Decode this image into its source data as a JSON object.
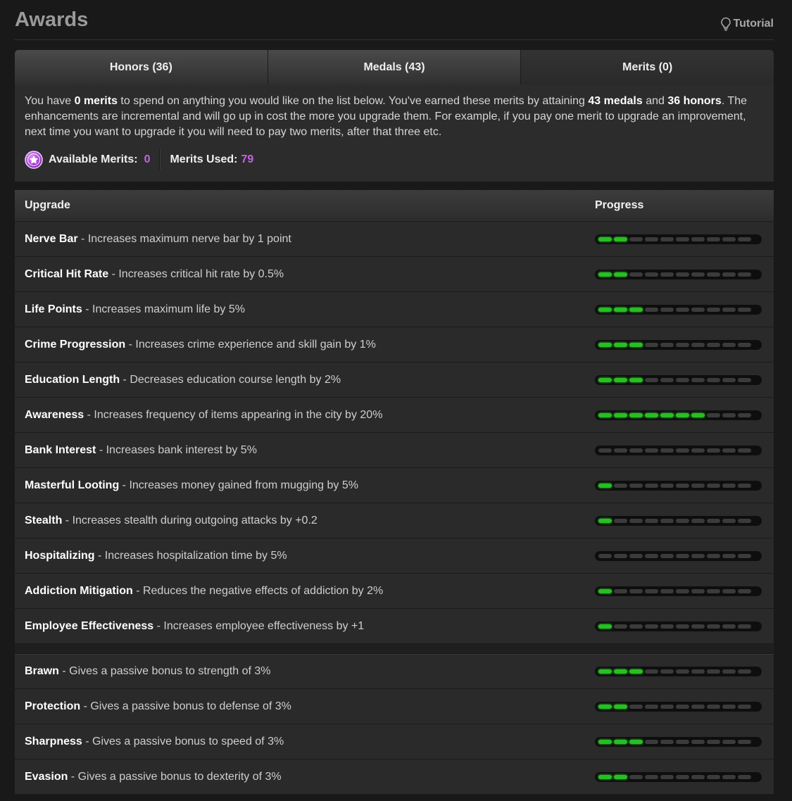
{
  "header": {
    "title": "Awards",
    "tutorial_label": "Tutorial"
  },
  "tabs": [
    {
      "label": "Honors (36)",
      "active": false
    },
    {
      "label": "Medals (43)",
      "active": false
    },
    {
      "label": "Merits (0)",
      "active": true
    }
  ],
  "info": {
    "text_1": "You have ",
    "merits_phrase": "0 merits",
    "text_2": " to spend on anything you would like on the list below. You've earned these merits by attaining ",
    "medals_phrase": "43 medals",
    "text_3": " and ",
    "honors_phrase": "36 honors",
    "text_4": ". The enhancements are incremental and will go up in cost the more you upgrade them. For example, if you pay one merit to upgrade an improvement, next time you want to upgrade it you will need to pay two merits, after that three etc.",
    "available_label": "Available Merits:",
    "available_value": "0",
    "used_label": "Merits Used:",
    "used_value": "79",
    "accent_color": "#c563e3"
  },
  "table": {
    "col_upgrade": "Upgrade",
    "col_progress": "Progress",
    "max_level": 10,
    "groups": [
      [
        {
          "name": "Nerve Bar",
          "desc": " - Increases maximum nerve bar by 1 point",
          "level": 2
        },
        {
          "name": "Critical Hit Rate",
          "desc": " - Increases critical hit rate by 0.5%",
          "level": 2
        },
        {
          "name": "Life Points",
          "desc": " - Increases maximum life by 5%",
          "level": 3
        },
        {
          "name": "Crime Progression",
          "desc": " - Increases crime experience and skill gain by 1%",
          "level": 3
        },
        {
          "name": "Education Length",
          "desc": " - Decreases education course length by 2%",
          "level": 3
        },
        {
          "name": "Awareness",
          "desc": " - Increases frequency of items appearing in the city by 20%",
          "level": 7
        },
        {
          "name": "Bank Interest",
          "desc": " - Increases bank interest by 5%",
          "level": 0
        },
        {
          "name": "Masterful Looting",
          "desc": " - Increases money gained from mugging by 5%",
          "level": 1
        },
        {
          "name": "Stealth",
          "desc": " - Increases stealth during outgoing attacks by +0.2",
          "level": 1
        },
        {
          "name": "Hospitalizing",
          "desc": " - Increases hospitalization time by 5%",
          "level": 0
        },
        {
          "name": "Addiction Mitigation",
          "desc": " - Reduces the negative effects of addiction by 2%",
          "level": 1
        },
        {
          "name": "Employee Effectiveness",
          "desc": " - Increases employee effectiveness by +1",
          "level": 1
        }
      ],
      [
        {
          "name": "Brawn",
          "desc": " - Gives a passive bonus to strength of 3%",
          "level": 3
        },
        {
          "name": "Protection",
          "desc": " - Gives a passive bonus to defense of 3%",
          "level": 2
        },
        {
          "name": "Sharpness",
          "desc": " - Gives a passive bonus to speed of 3%",
          "level": 3
        },
        {
          "name": "Evasion",
          "desc": " - Gives a passive bonus to dexterity of 3%",
          "level": 2
        }
      ]
    ]
  }
}
